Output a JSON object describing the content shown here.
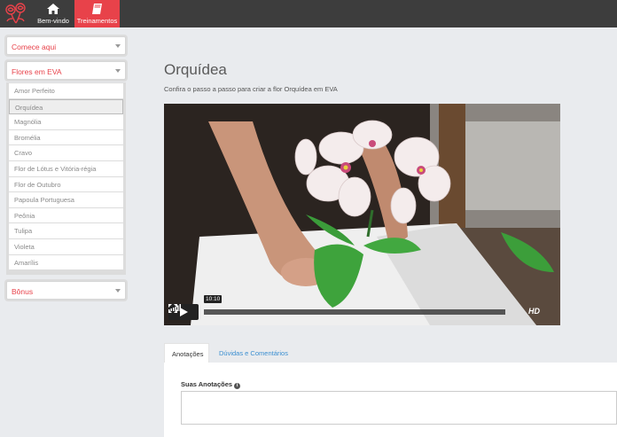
{
  "topbar": {
    "nav": [
      {
        "label": "Bem-vindo",
        "icon": "home-icon"
      },
      {
        "label": "Treinamentos",
        "icon": "book-icon",
        "active": true
      }
    ],
    "accent": "#e8424a"
  },
  "sidebar": {
    "sections": [
      {
        "label": "Comece aqui",
        "expanded": false
      },
      {
        "label": "Flores em EVA",
        "expanded": true
      },
      {
        "label": "Bônus",
        "expanded": false
      }
    ],
    "lessons": [
      {
        "label": "Amor Perfeito"
      },
      {
        "label": "Orquídea",
        "active": true
      },
      {
        "label": "Magnólia"
      },
      {
        "label": "Bromélia"
      },
      {
        "label": "Cravo"
      },
      {
        "label": "Flor de Lótus e Vitória-régia"
      },
      {
        "label": "Flor de Outubro"
      },
      {
        "label": "Papoula Portuguesa"
      },
      {
        "label": "Peônia"
      },
      {
        "label": "Tulipa"
      },
      {
        "label": "Violeta"
      },
      {
        "label": "Amarílis"
      }
    ]
  },
  "main": {
    "title": "Orquídea",
    "subtitle": "Confira o passo a passo para criar a flor Orquídea em EVA",
    "video": {
      "time": "10:10",
      "hd_label": "HD",
      "progress": 0
    },
    "tabs": [
      {
        "label": "Anotações",
        "active": true
      },
      {
        "label": "Dúvidas e Comentários",
        "active": false
      }
    ],
    "notes": {
      "label": "Suas Anotações",
      "info": "i",
      "value": ""
    }
  }
}
